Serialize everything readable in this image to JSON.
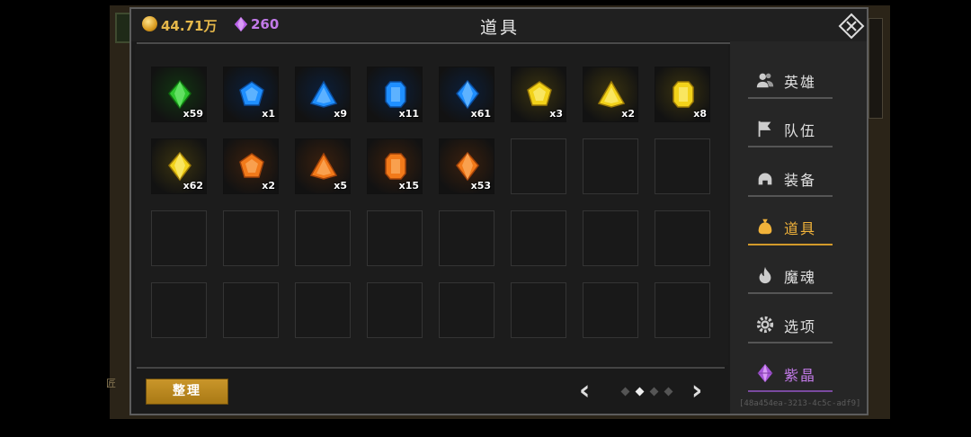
{
  "background": {
    "left_label": "匠"
  },
  "header": {
    "gold": "44.71万",
    "gems": "260",
    "title": "道具"
  },
  "inventory": {
    "items": [
      {
        "gem": "green-rhombus-gem",
        "qty": "x59"
      },
      {
        "gem": "blue-pentagon-gem",
        "qty": "x1"
      },
      {
        "gem": "blue-trillion-gem",
        "qty": "x9"
      },
      {
        "gem": "blue-emerald-gem",
        "qty": "x11"
      },
      {
        "gem": "blue-rhombus-gem",
        "qty": "x61"
      },
      {
        "gem": "yellow-pentagon-gem",
        "qty": "x3"
      },
      {
        "gem": "yellow-trillion-gem",
        "qty": "x2"
      },
      {
        "gem": "yellow-emerald-gem",
        "qty": "x8"
      },
      {
        "gem": "yellow-rhombus-gem",
        "qty": "x62"
      },
      {
        "gem": "orange-pentagon-gem",
        "qty": "x2"
      },
      {
        "gem": "orange-trillion-gem",
        "qty": "x5"
      },
      {
        "gem": "orange-emerald-gem",
        "qty": "x15"
      },
      {
        "gem": "orange-rhombus-gem",
        "qty": "x53"
      }
    ],
    "empty_slots": 19
  },
  "footer": {
    "sort_label": "整理",
    "pages": 4,
    "current_page": 2
  },
  "sidebar": {
    "items": [
      {
        "label": "英雄",
        "icon": "heroes-icon"
      },
      {
        "label": "队伍",
        "icon": "flag-icon"
      },
      {
        "label": "装备",
        "icon": "helmet-icon"
      },
      {
        "label": "道具",
        "icon": "bag-icon",
        "active": true
      },
      {
        "label": "魔魂",
        "icon": "flame-icon"
      },
      {
        "label": "选项",
        "icon": "gear-icon"
      },
      {
        "label": "紫晶",
        "icon": "crystal-icon"
      }
    ],
    "build_id": "[48a454ea-3213-4c5c-adf9]"
  },
  "colors": {
    "gold": "#e6b84a",
    "purple": "#c27ae8",
    "active_tab": "#f2b33a",
    "green_gem": "#2fc62f",
    "blue_gem": "#1f8fff",
    "yellow_gem": "#f2d21a",
    "orange_gem": "#f27a1a"
  }
}
